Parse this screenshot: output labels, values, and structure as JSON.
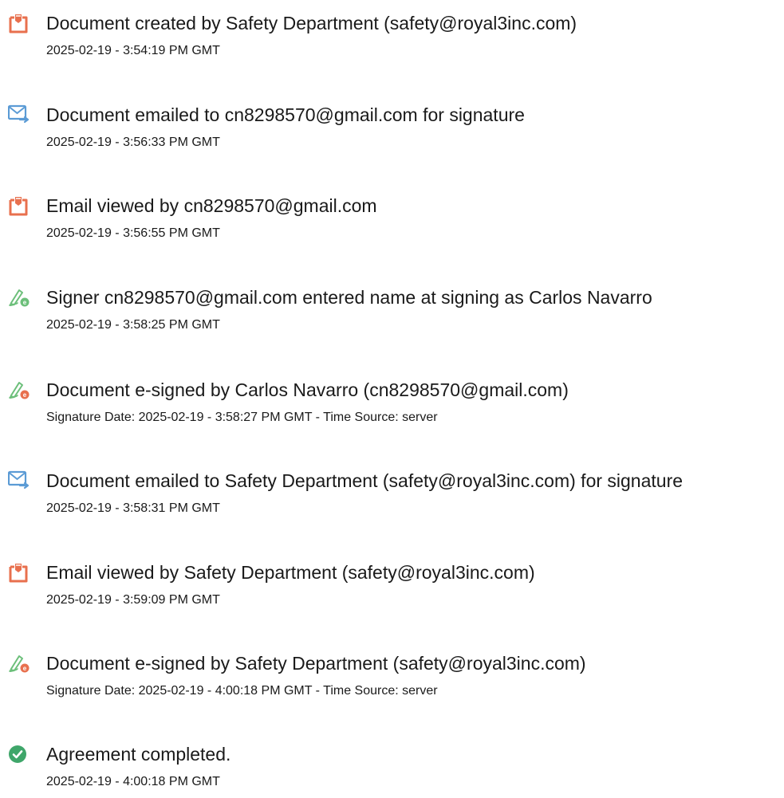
{
  "colors": {
    "doc_icon": "#e8704e",
    "email_icon": "#5b9bd5",
    "sign_icon": "#6cbf7a",
    "complete_icon": "#3fa66a",
    "text": "#1a1a1a"
  },
  "events": [
    {
      "icon": "document-icon",
      "title": "Document created by Safety Department (safety@royal3inc.com)",
      "sub": "2025-02-19 - 3:54:19 PM GMT"
    },
    {
      "icon": "email-sent-icon",
      "title": "Document emailed to cn8298570@gmail.com for signature",
      "sub": "2025-02-19 - 3:56:33 PM GMT"
    },
    {
      "icon": "document-icon",
      "title": "Email viewed by cn8298570@gmail.com",
      "sub": "2025-02-19 - 3:56:55 PM GMT"
    },
    {
      "icon": "e-sign-pen-icon",
      "title": "Signer cn8298570@gmail.com entered name at signing as Carlos Navarro",
      "sub": "2025-02-19 - 3:58:25 PM GMT"
    },
    {
      "icon": "e-sign-pen-icon",
      "title": "Document e-signed by Carlos Navarro (cn8298570@gmail.com)",
      "sub": "Signature Date: 2025-02-19 - 3:58:27 PM GMT - Time Source: server"
    },
    {
      "icon": "email-sent-icon",
      "title": "Document emailed to Safety Department (safety@royal3inc.com) for signature",
      "sub": "2025-02-19 - 3:58:31 PM GMT"
    },
    {
      "icon": "document-icon",
      "title": "Email viewed by Safety Department (safety@royal3inc.com)",
      "sub": "2025-02-19 - 3:59:09 PM GMT"
    },
    {
      "icon": "e-sign-pen-icon",
      "title": "Document e-signed by Safety Department (safety@royal3inc.com)",
      "sub": "Signature Date: 2025-02-19 - 4:00:18 PM GMT - Time Source: server"
    },
    {
      "icon": "checkmark-circle-icon",
      "title": "Agreement completed.",
      "sub": "2025-02-19 - 4:00:18 PM GMT"
    }
  ]
}
